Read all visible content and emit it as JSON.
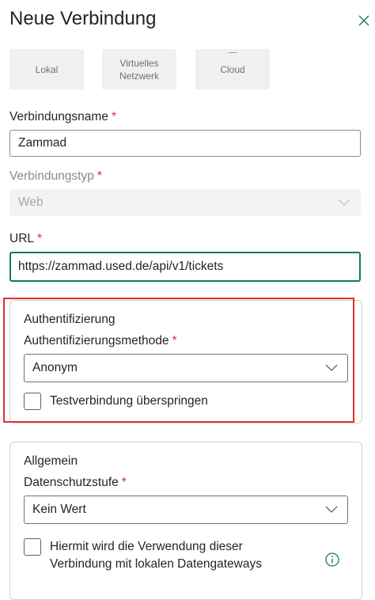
{
  "header": {
    "title": "Neue Verbindung"
  },
  "tiles": [
    {
      "label": "Lokal"
    },
    {
      "label_line1": "Virtuelles",
      "label_line2": "Netzwerk"
    },
    {
      "label": "Cloud"
    }
  ],
  "fields": {
    "name": {
      "label": "Verbindungsname",
      "required": "*",
      "value": "Zammad"
    },
    "type": {
      "label": "Verbindungstyp",
      "required": "*",
      "value": "Web"
    },
    "url": {
      "label": "URL",
      "required": "*",
      "value": "https://zammad.used.de/api/v1/tickets"
    }
  },
  "auth": {
    "title": "Authentifizierung",
    "method_label": "Authentifizierungsmethode",
    "required": "*",
    "method_value": "Anonym",
    "skip_test_label": "Testverbindung überspringen"
  },
  "general": {
    "title": "Allgemein",
    "privacy_label": "Datenschutzstufe",
    "required": "*",
    "privacy_value": "Kein Wert",
    "gateway_label_line1": "Hiermit wird die Verwendung dieser",
    "gateway_label_line2": "Verbindung mit lokalen Datengateways"
  },
  "colors": {
    "accent": "#117865",
    "highlight": "#e0312e",
    "required": "#c4314b"
  }
}
